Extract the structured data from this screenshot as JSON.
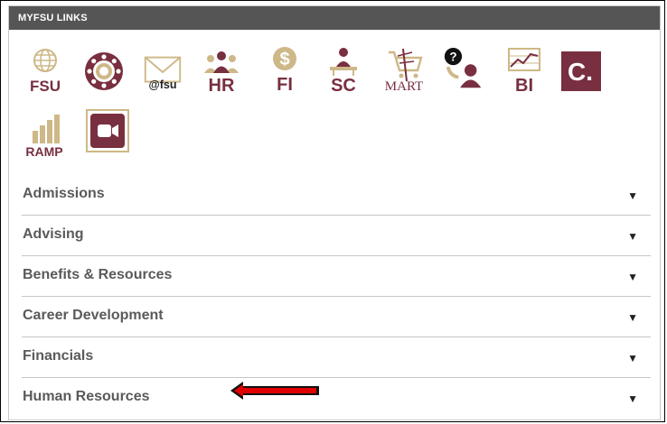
{
  "panel": {
    "title": "MYFSU LINKS"
  },
  "icons": [
    {
      "name": "fsu-icon",
      "label": "FSU"
    },
    {
      "name": "canvas-icon",
      "label": ""
    },
    {
      "name": "email-icon",
      "label": "@fsu"
    },
    {
      "name": "hr-icon",
      "label": "HR"
    },
    {
      "name": "fi-icon",
      "label": "FI"
    },
    {
      "name": "sc-icon",
      "label": "SC"
    },
    {
      "name": "mart-icon",
      "label": "MART"
    },
    {
      "name": "help-desk-icon",
      "label": ""
    },
    {
      "name": "bi-icon",
      "label": "BI"
    },
    {
      "name": "c-app-icon",
      "label": "C."
    },
    {
      "name": "ramp-icon",
      "label": "RAMP"
    },
    {
      "name": "zoom-icon",
      "label": ""
    }
  ],
  "accordion": {
    "items": [
      {
        "label": "Admissions"
      },
      {
        "label": "Advising"
      },
      {
        "label": "Benefits & Resources"
      },
      {
        "label": "Career Development"
      },
      {
        "label": "Financials"
      },
      {
        "label": "Human Resources"
      }
    ],
    "caret": "▼"
  },
  "colors": {
    "garnet": "#782f40",
    "gold": "#ceb888",
    "header_bg": "#555555",
    "arrow": "#e00000"
  }
}
